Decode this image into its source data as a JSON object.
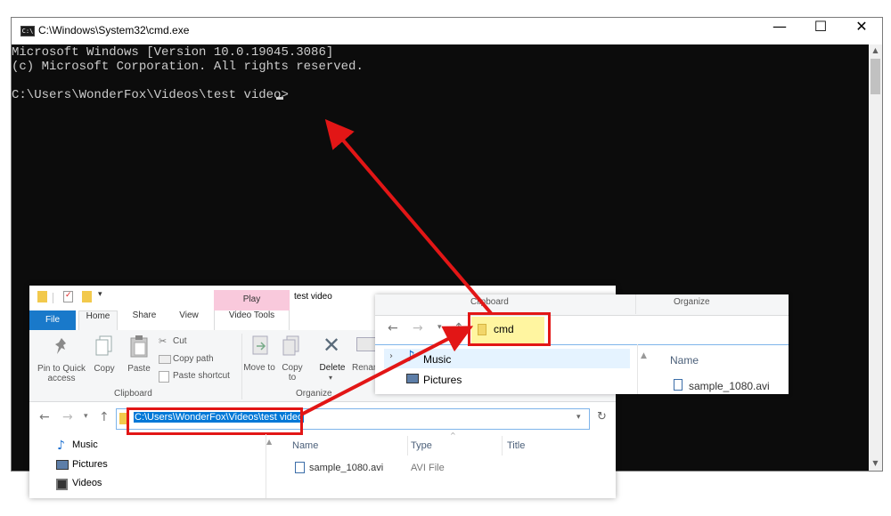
{
  "cmd": {
    "title": "C:\\Windows\\System32\\cmd.exe",
    "icon_text": "C:\\",
    "controls": {
      "minimize": "—",
      "maximize": "☐",
      "close": "✕"
    },
    "lines": [
      "Microsoft Windows [Version 10.0.19045.3086]",
      "(c) Microsoft Corporation. All rights reserved.",
      "",
      "C:\\Users\\WonderFox\\Videos\\test video>"
    ]
  },
  "explorer": {
    "window_title": "test video",
    "context_tab": "Play",
    "tabs": {
      "file": "File",
      "home": "Home",
      "share": "Share",
      "view": "View",
      "video_tools": "Video Tools"
    },
    "ribbon": {
      "pin": "Pin to Quick access",
      "copy": "Copy",
      "paste": "Paste",
      "cut": "Cut",
      "copy_path": "Copy path",
      "paste_shortcut": "Paste shortcut",
      "clipboard_group": "Clipboard",
      "move_to": "Move to",
      "copy_to": "Copy to",
      "delete": "Delete",
      "rename": "Renam",
      "organize_group": "Organize"
    },
    "address": "C:\\Users\\WonderFox\\Videos\\test video",
    "nav_items": [
      "Music",
      "Pictures",
      "Videos"
    ],
    "columns": {
      "name": "Name",
      "type": "Type",
      "title": "Title"
    },
    "files": [
      {
        "name": "sample_1080.avi",
        "type": "AVI File"
      }
    ]
  },
  "zoom": {
    "clipboard_group": "Clipboard",
    "organize_group": "Organize",
    "address": "cmd",
    "nav_items": [
      "Music",
      "Pictures"
    ],
    "name_column": "Name",
    "file": "sample_1080.avi"
  },
  "colors": {
    "highlight_border": "#e21616",
    "selection": "#0078d7",
    "context_tab": "#f9c9dc",
    "file_tab": "#1979ca"
  }
}
